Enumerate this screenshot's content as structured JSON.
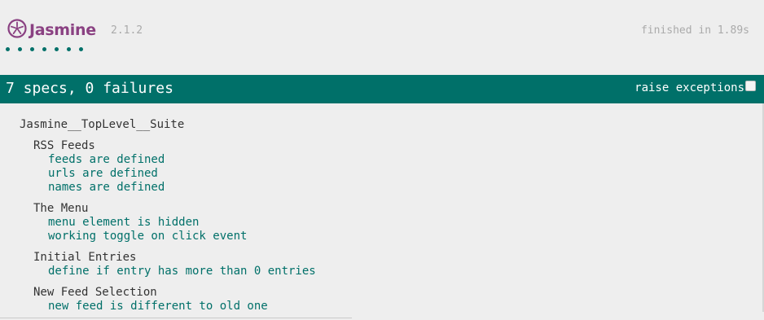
{
  "banner": {
    "logo_text": "Jasmine",
    "version": "2.1.2",
    "duration": "finished in 1.89s",
    "dots": 7
  },
  "bar": {
    "summary": "7 specs, 0 failures",
    "options_label": "raise exceptions"
  },
  "results": {
    "top_suite": "Jasmine__TopLevel__Suite",
    "suites": [
      {
        "title": "RSS Feeds",
        "specs": [
          "feeds are defined",
          "urls are defined",
          "names are defined"
        ]
      },
      {
        "title": "The Menu",
        "specs": [
          "menu element is hidden",
          "working toggle on click event"
        ]
      },
      {
        "title": "Initial Entries",
        "specs": [
          "define if entry has more than 0 entries"
        ]
      },
      {
        "title": "New Feed Selection",
        "specs": [
          "new feed is different to old one"
        ]
      }
    ]
  },
  "colors": {
    "brand": "#8a4182",
    "passed": "#007069",
    "background": "#eeeeee"
  }
}
